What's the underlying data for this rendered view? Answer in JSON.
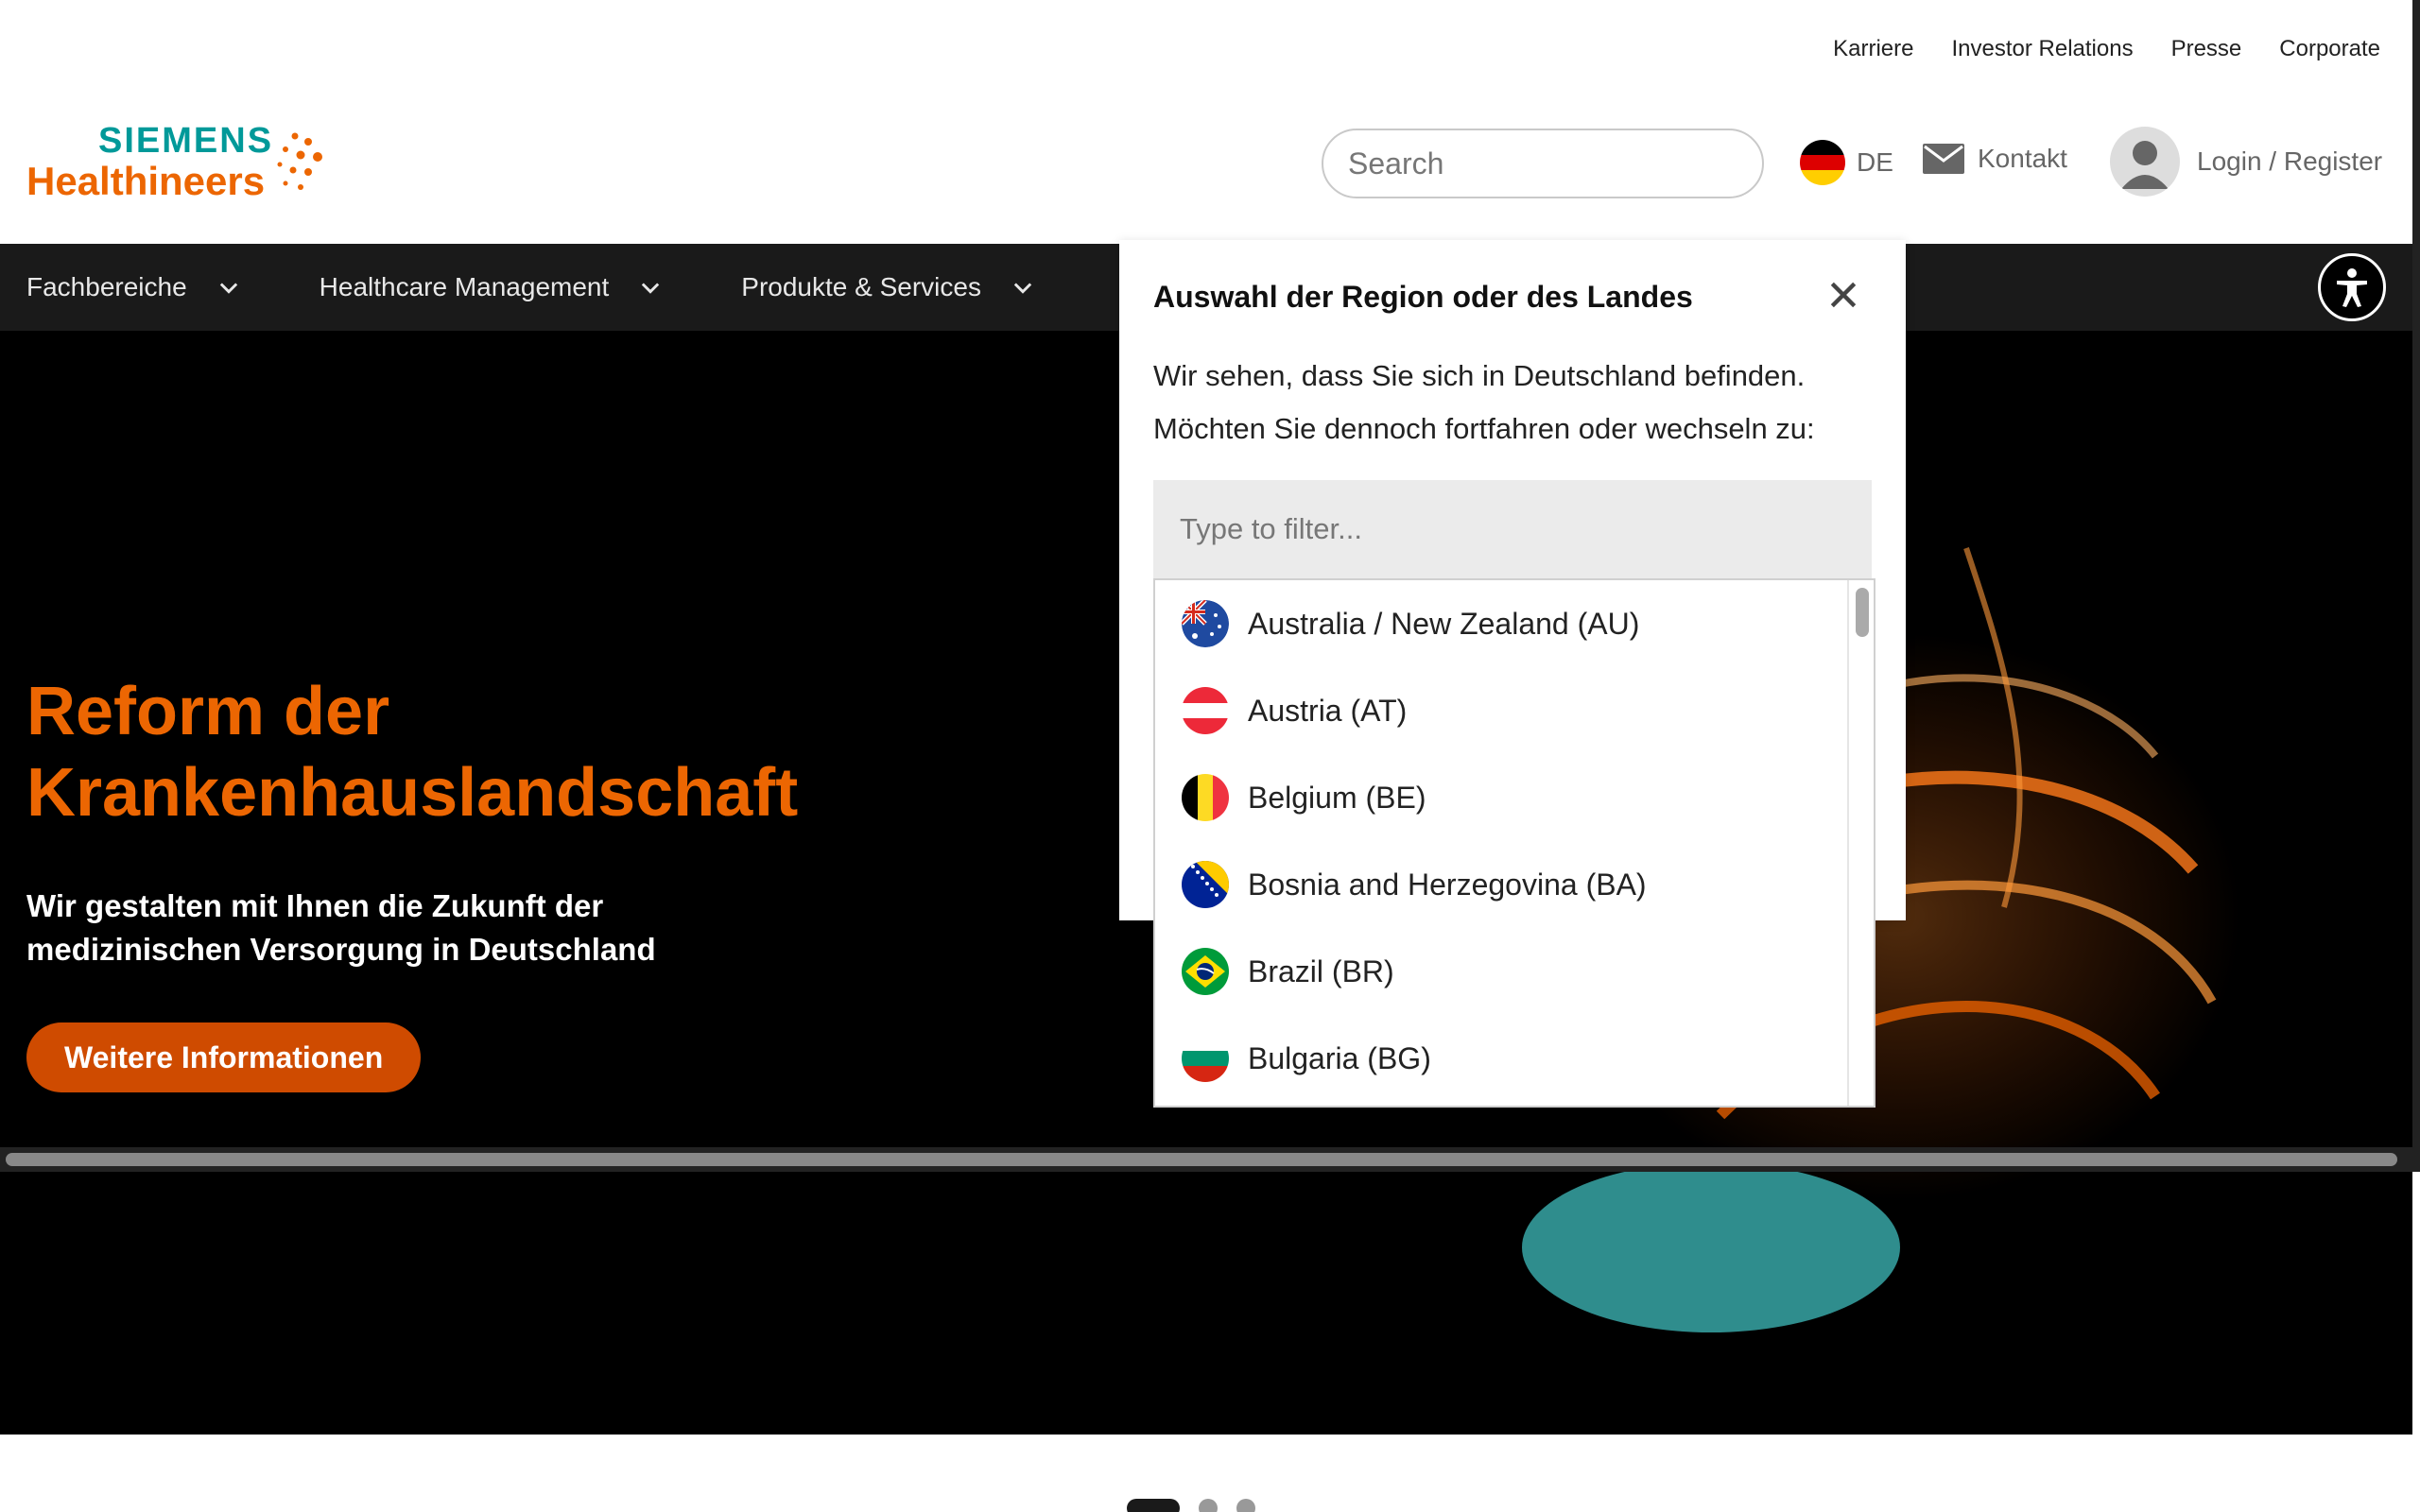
{
  "utility_nav": [
    "Karriere",
    "Investor Relations",
    "Presse",
    "Corporate"
  ],
  "logo": {
    "line1": "SIEMENS",
    "line2": "Healthineers"
  },
  "search": {
    "placeholder": "Search"
  },
  "language": {
    "code": "DE"
  },
  "contact": {
    "label": "Kontakt"
  },
  "login": {
    "label": "Login / Register"
  },
  "main_nav": [
    "Fachbereiche",
    "Healthcare Management",
    "Produkte & Services"
  ],
  "hero": {
    "title": "Reform der Krankenhauslandschaft",
    "subtitle": "Wir gestalten mit Ihnen die Zukunft der medizinischen Versorgung in Deutschland",
    "cta": "Weitere Informationen"
  },
  "region_popover": {
    "title": "Auswahl der Region oder des Landes",
    "message": "Wir sehen, dass Sie sich in Deutschland befinden. Möchten Sie dennoch fortfahren oder wechseln zu:",
    "filter_placeholder": "Type to filter...",
    "countries": [
      "Australia / New Zealand (AU)",
      "Austria (AT)",
      "Belgium (BE)",
      "Bosnia and Herzegovina (BA)",
      "Brazil (BR)",
      "Bulgaria (BG)"
    ]
  },
  "colors": {
    "brand_orange": "#ec6602",
    "brand_teal": "#009999",
    "nav_bg": "#1a1a1a",
    "cta_bg": "#cf4b00"
  },
  "carousel": {
    "total": 3,
    "active": 1
  }
}
